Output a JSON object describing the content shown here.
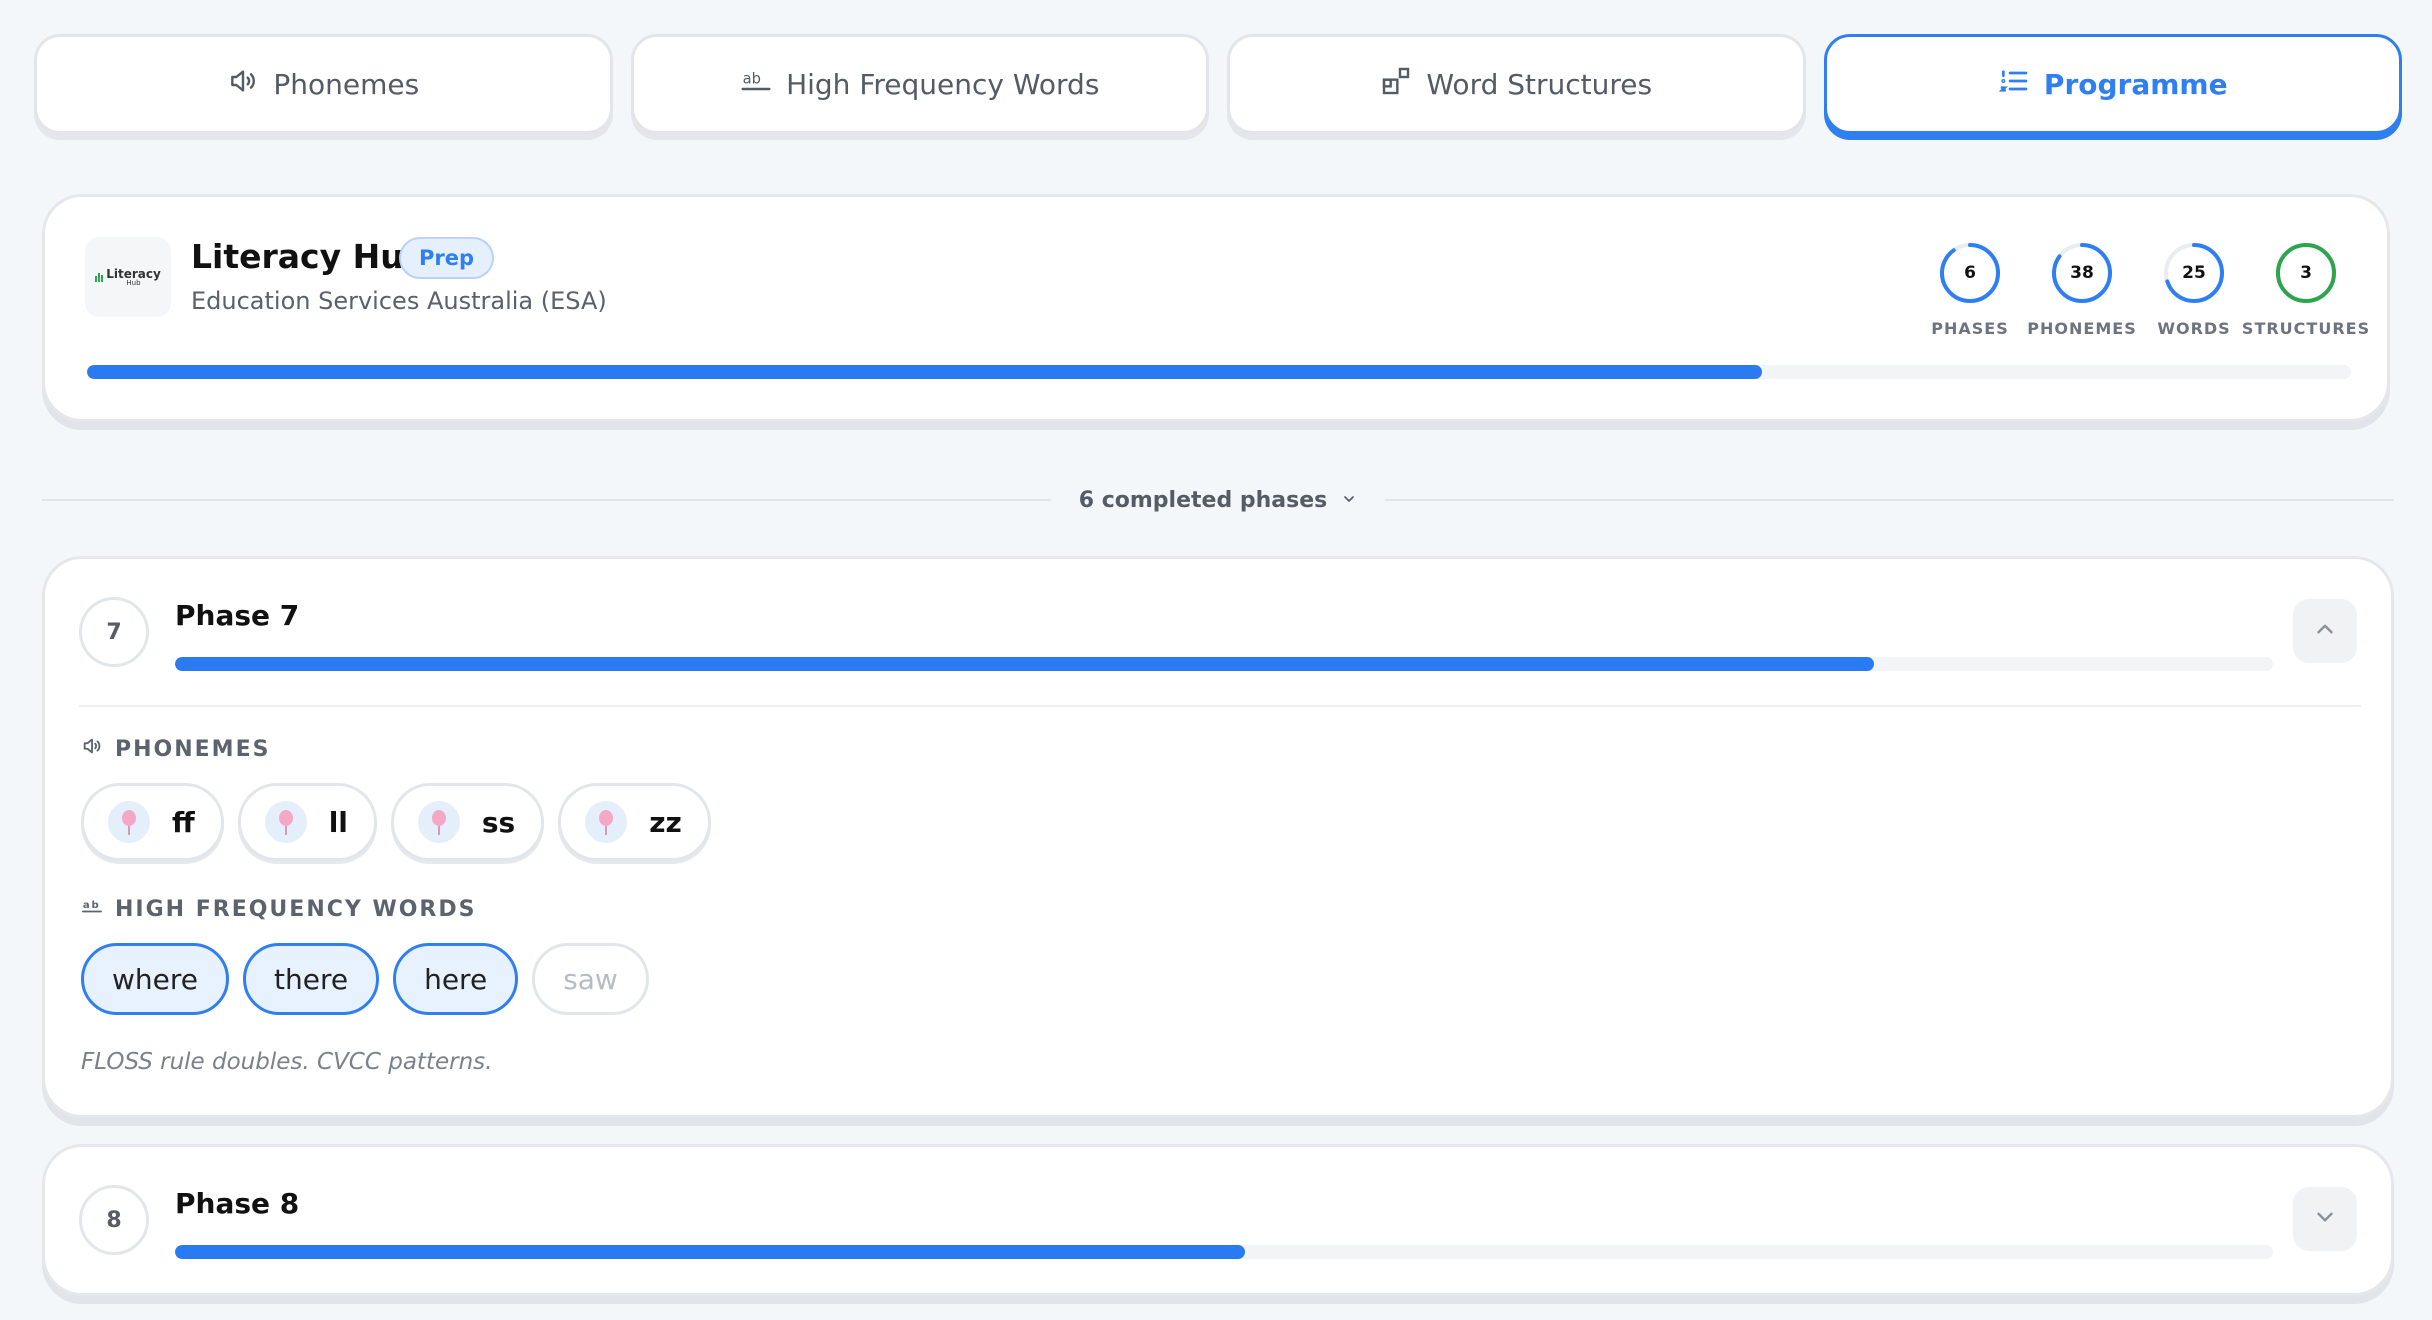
{
  "tabs": [
    {
      "label": "Phonemes",
      "icon": "speaker-icon",
      "active": false
    },
    {
      "label": "High Frequency Words",
      "icon": "ab-icon",
      "active": false
    },
    {
      "label": "Word Structures",
      "icon": "blocks-icon",
      "active": false
    },
    {
      "label": "Programme",
      "icon": "list-icon",
      "active": true
    }
  ],
  "programme": {
    "logo_text": "Literacy",
    "logo_subtext": "Hub",
    "title": "Literacy Hub",
    "badge": "Prep",
    "subtitle": "Education Services Australia (ESA)",
    "progress": 0.74,
    "stats": [
      {
        "value": "6",
        "label": "PHASES",
        "fraction": 0.9,
        "color": "#2f7ff0"
      },
      {
        "value": "38",
        "label": "PHONEMES",
        "fraction": 0.85,
        "color": "#2f7ff0"
      },
      {
        "value": "25",
        "label": "WORDS",
        "fraction": 0.7,
        "color": "#2f7ff0"
      },
      {
        "value": "3",
        "label": "STRUCTURES",
        "fraction": 1.0,
        "color": "#2ea44f"
      }
    ]
  },
  "divider": {
    "label": "6 completed phases"
  },
  "phase7": {
    "number": "7",
    "title": "Phase 7",
    "progress": 0.81,
    "phonemes_label": "PHONEMES",
    "phonemes": [
      "ff",
      "ll",
      "ss",
      "zz"
    ],
    "hfw_label": "HIGH FREQUENCY WORDS",
    "words": [
      {
        "text": "where",
        "active": true
      },
      {
        "text": "there",
        "active": true
      },
      {
        "text": "here",
        "active": true
      },
      {
        "text": "saw",
        "active": false
      }
    ],
    "note": "FLOSS rule doubles. CVCC patterns."
  },
  "phase8": {
    "number": "8",
    "title": "Phase 8",
    "progress": 0.51
  },
  "colors": {
    "accent": "#2f7ff0",
    "bar": "#2a7bf1",
    "success": "#2ea44f"
  }
}
